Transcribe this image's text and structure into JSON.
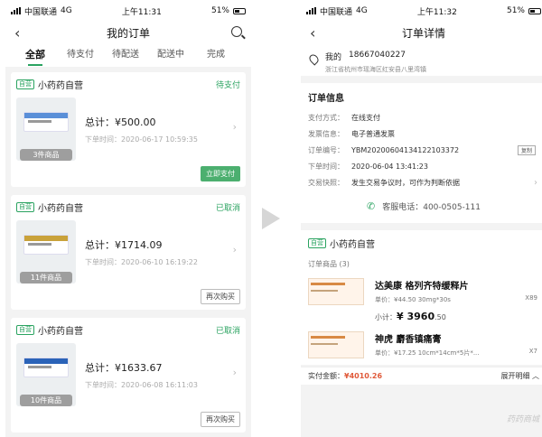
{
  "status_left": {
    "carrier": "中国联通",
    "network": "4G",
    "time": "上午11:31",
    "battery": "51%"
  },
  "status_right": {
    "carrier": "中国联通",
    "network": "4G",
    "time": "上午11:32",
    "battery": "51%"
  },
  "left": {
    "title": "我的订单",
    "tabs": [
      "全部",
      "待支付",
      "待配送",
      "配送中",
      "完成"
    ],
    "orders": [
      {
        "tag": "自营",
        "shop": "小药药自营",
        "status": "待支付",
        "total": "总计：¥500.00",
        "time": "下单时间：2020-06-17 10:59:35",
        "count": "3件商品",
        "action": "立即支付",
        "color": "#5a8fd8"
      },
      {
        "tag": "自营",
        "shop": "小药药自营",
        "status": "已取消",
        "total": "总计：¥1714.09",
        "time": "下单时间：2020-06-10 16:19:22",
        "count": "11件商品",
        "action": "再次购买",
        "color": "#c9a23a"
      },
      {
        "tag": "自营",
        "shop": "小药药自营",
        "status": "已取消",
        "total": "总计：¥1633.67",
        "time": "下单时间：2020-06-08 16:11:03",
        "count": "10件商品",
        "action": "再次购买",
        "color": "#2b63b8"
      }
    ]
  },
  "right": {
    "title": "订单详情",
    "address": {
      "name": "我的",
      "phone": "18667040227",
      "line": "浙江省杭州市瑶海区红安县八里湾镇"
    },
    "info_title": "订单信息",
    "rows": [
      {
        "k": "支付方式：",
        "v": "在线支付"
      },
      {
        "k": "发票信息：",
        "v": "电子普通发票"
      },
      {
        "k": "订单编号：",
        "v": "YBM20200604134122103372",
        "btn": "复制"
      },
      {
        "k": "下单时间：",
        "v": "2020-06-04 13:41:23"
      },
      {
        "k": "交易快照：",
        "v": "发生交易争议时，可作为判断依据"
      }
    ],
    "service": "客服电话：400-0505-111",
    "shop_tag": "自营",
    "shop": "小药药自营",
    "prod_count": "订单商品 (3)",
    "products": [
      {
        "name": "达美康 格列齐特缓释片",
        "price": "单价：¥44.50 30mg*30s",
        "qty": "X89",
        "subtotal_label": "小计：",
        "subtotal": "¥ 3960",
        "subtotal_dec": ".50"
      },
      {
        "name": "神虎 麝香镇痛膏",
        "price": "单价：¥17.25 10cm*14cm*5片*...",
        "qty": "X7"
      }
    ],
    "paybar": {
      "label": "实付金额：",
      "amount": "¥4010.26",
      "expand": "展开明细 ︿"
    },
    "watermark": "药药商城"
  }
}
